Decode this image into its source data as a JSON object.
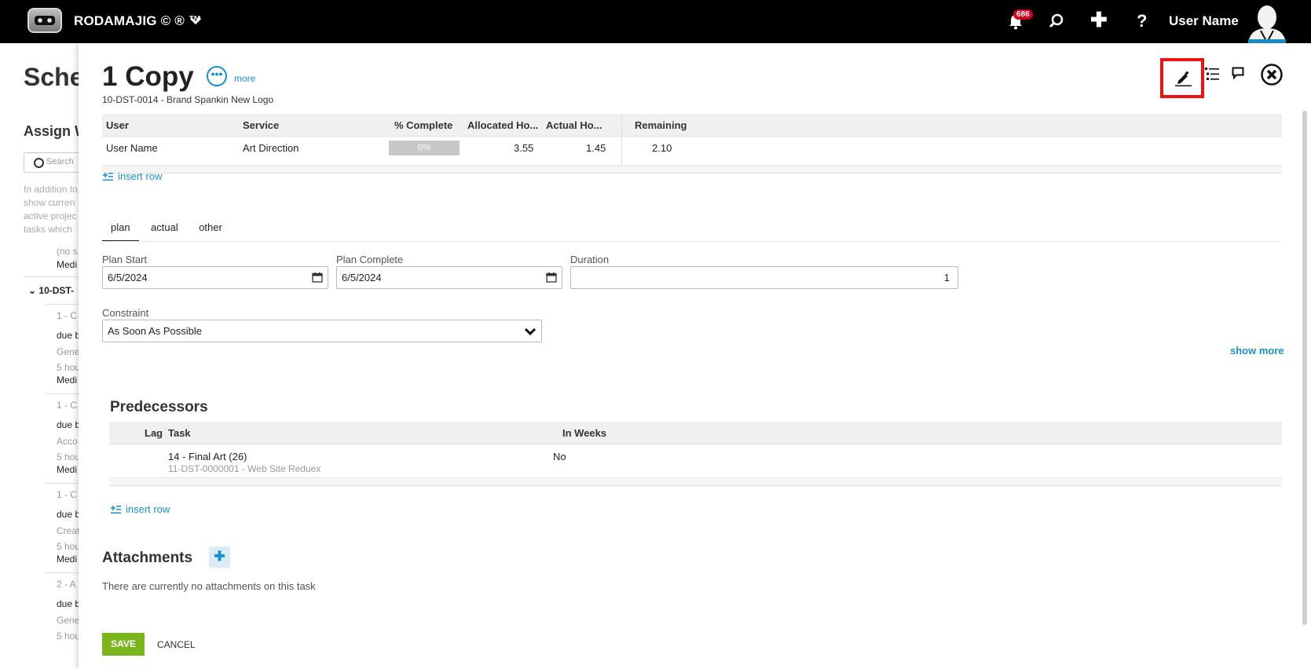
{
  "topbar": {
    "brand": "RODAMAJIG © ® ™",
    "notification_count": "686",
    "user_name": "User Name"
  },
  "background": {
    "title": "Sche",
    "subtitle": "Assign W",
    "search_placeholder": "Search",
    "help_lines": [
      "In addition to",
      "show curren",
      "active projec",
      "tasks which"
    ],
    "items": [
      {
        "text": "(no s",
        "dark": false
      },
      {
        "text": "Medi",
        "dark": true
      },
      {
        "text": "10-DST-",
        "dark": true
      },
      {
        "text": "1 - C",
        "dark": false
      },
      {
        "text": "due b",
        "dark": true
      },
      {
        "text": "Gene",
        "dark": false
      },
      {
        "text": "5 hou",
        "dark": false
      },
      {
        "text": "Medi",
        "dark": true
      },
      {
        "text": "1 - C",
        "dark": false
      },
      {
        "text": "due b",
        "dark": true
      },
      {
        "text": "Acco",
        "dark": false
      },
      {
        "text": "5 hou",
        "dark": false
      },
      {
        "text": "Medi",
        "dark": true
      },
      {
        "text": "1 - C",
        "dark": false
      },
      {
        "text": "due b",
        "dark": true
      },
      {
        "text": "Creat",
        "dark": false
      },
      {
        "text": "5 hou",
        "dark": false
      },
      {
        "text": "Medi",
        "dark": true
      },
      {
        "text": "2 - A",
        "dark": false
      },
      {
        "text": "due b",
        "dark": true
      },
      {
        "text": "Gene",
        "dark": false
      },
      {
        "text": "5 hou",
        "dark": false
      }
    ]
  },
  "panel": {
    "title": "1 Copy",
    "more_label": "more",
    "subtitle": "10-DST-0014 - Brand Spankin New Logo",
    "assignments": {
      "headers": [
        "User",
        "Service",
        "% Complete",
        "Allocated Ho...",
        "Actual Ho...",
        "Remaining"
      ],
      "rows": [
        {
          "user": "User Name",
          "service": "Art Direction",
          "percent_complete": "0%",
          "allocated": "3.55",
          "actual": "1.45",
          "remaining": "2.10"
        }
      ],
      "insert_row": "insert row"
    },
    "tabs": [
      "plan",
      "actual",
      "other"
    ],
    "active_tab": "plan",
    "plan_start": {
      "label": "Plan Start",
      "value": "6/5/2024"
    },
    "plan_complete": {
      "label": "Plan Complete",
      "value": "6/5/2024"
    },
    "duration": {
      "label": "Duration",
      "value": "1"
    },
    "constraint": {
      "label": "Constraint",
      "value": "As Soon As Possible"
    },
    "show_more": "show more",
    "predecessors": {
      "title": "Predecessors",
      "headers": [
        "Lag",
        "Task",
        "In Weeks"
      ],
      "rows": [
        {
          "lag": "",
          "task": "14 - Final Art (26)",
          "project": "11-DST-0000001 - Web Site Reduex",
          "in_weeks": "No"
        }
      ],
      "insert_row": "insert row"
    },
    "attachments": {
      "title": "Attachments",
      "empty_text": "There are currently no attachments on this task"
    },
    "save_label": "SAVE",
    "cancel_label": "CANCEL"
  },
  "colors": {
    "accent": "#1a90c9",
    "save": "#7ab51d",
    "highlight": "#ee1111",
    "badge": "#d0021b"
  },
  "icons": [
    "logo-icon",
    "chevron-down-icon",
    "bell-icon",
    "search-icon",
    "plus-icon",
    "help-icon",
    "avatar",
    "ellipsis-icon",
    "pencil-icon",
    "list-icon",
    "comment-icon",
    "close-icon",
    "insert-row-icon",
    "calendar-icon"
  ]
}
